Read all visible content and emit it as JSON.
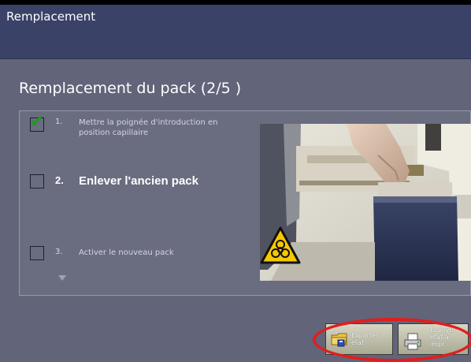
{
  "window": {
    "title": "Remplacement"
  },
  "page": {
    "heading": "Remplacement du pack (2/5 )"
  },
  "steps": [
    {
      "number": "1.",
      "label_line1": "Mettre la poignée d'introduction en",
      "label_line2": "position capillaire",
      "checked": true
    },
    {
      "number": "2.",
      "label": "Enlever l'ancien pack",
      "checked": false,
      "active": true
    },
    {
      "number": "3.",
      "label": "Activer le nouveau pack",
      "checked": false
    }
  ],
  "buttons": {
    "export": {
      "line1": "Exporter",
      "line2": "état"
    },
    "print": {
      "line1": "Envoyer",
      "line2": "état à",
      "line3": "impr."
    }
  },
  "icons": {
    "checkmark": "check-icon",
    "biohazard": "biohazard-icon",
    "export": "export-folder-icon",
    "print": "printer-icon"
  },
  "colors": {
    "titlebar": "#3b4268",
    "background": "#626479",
    "check": "#1d9b1d",
    "highlight": "#e01e1e"
  }
}
